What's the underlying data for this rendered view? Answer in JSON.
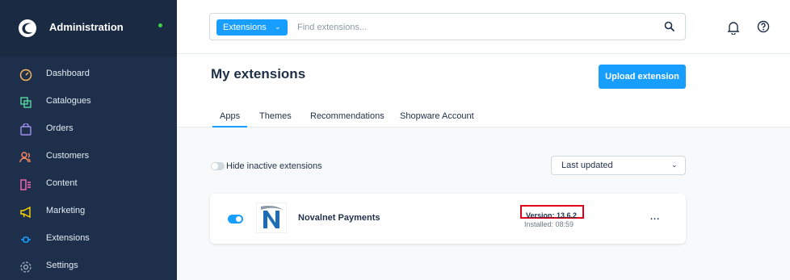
{
  "sidebar": {
    "title": "Administration",
    "items": [
      {
        "label": "Dashboard",
        "icon": "gauge-icon",
        "color": "#ffbd5d"
      },
      {
        "label": "Catalogues",
        "icon": "products-icon",
        "color": "#57d9a3"
      },
      {
        "label": "Orders",
        "icon": "bag-icon",
        "color": "#a092f0"
      },
      {
        "label": "Customers",
        "icon": "users-icon",
        "color": "#f88962"
      },
      {
        "label": "Content",
        "icon": "content-icon",
        "color": "#ff68b4"
      },
      {
        "label": "Marketing",
        "icon": "megaphone-icon",
        "color": "#ffd700"
      },
      {
        "label": "Extensions",
        "icon": "plugin-icon",
        "color": "#189eff"
      },
      {
        "label": "Settings",
        "icon": "gear-icon",
        "color": "#9aa8b5"
      }
    ]
  },
  "search": {
    "scope": "Extensions",
    "placeholder": "Find extensions..."
  },
  "page": {
    "title": "My extensions",
    "upload_label": "Upload extension",
    "tabs": [
      "Apps",
      "Themes",
      "Recommendations",
      "Shopware Account"
    ],
    "active_tab": "Apps",
    "hide_inactive_label": "Hide inactive extensions",
    "sort_value": "Last updated"
  },
  "extension": {
    "name": "Novalnet Payments",
    "version": "Version: 13.6.2",
    "installed": "Installed: 08:59",
    "more": "..."
  },
  "colors": {
    "accent": "#189eff",
    "sidebar_bg": "#1e2f4b",
    "highlight": "#e0001a"
  }
}
